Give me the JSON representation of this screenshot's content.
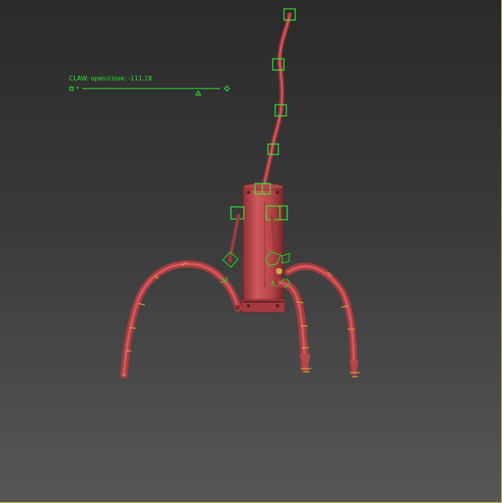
{
  "viewport": {
    "background_top": "#2a2a2a",
    "background_bottom": "#575757",
    "accent_color": "#2ee82e",
    "mesh_color": "#c0474a",
    "gizmo_color": "#33ee33",
    "wire_color": "#d8a23a"
  },
  "claw_control": {
    "label": "CLAW: open/close:",
    "value": "-111.18",
    "slider_level": 0.84
  },
  "icons": [
    "slider-min-icon",
    "slider-max-icon",
    "slider-handle-icon"
  ]
}
